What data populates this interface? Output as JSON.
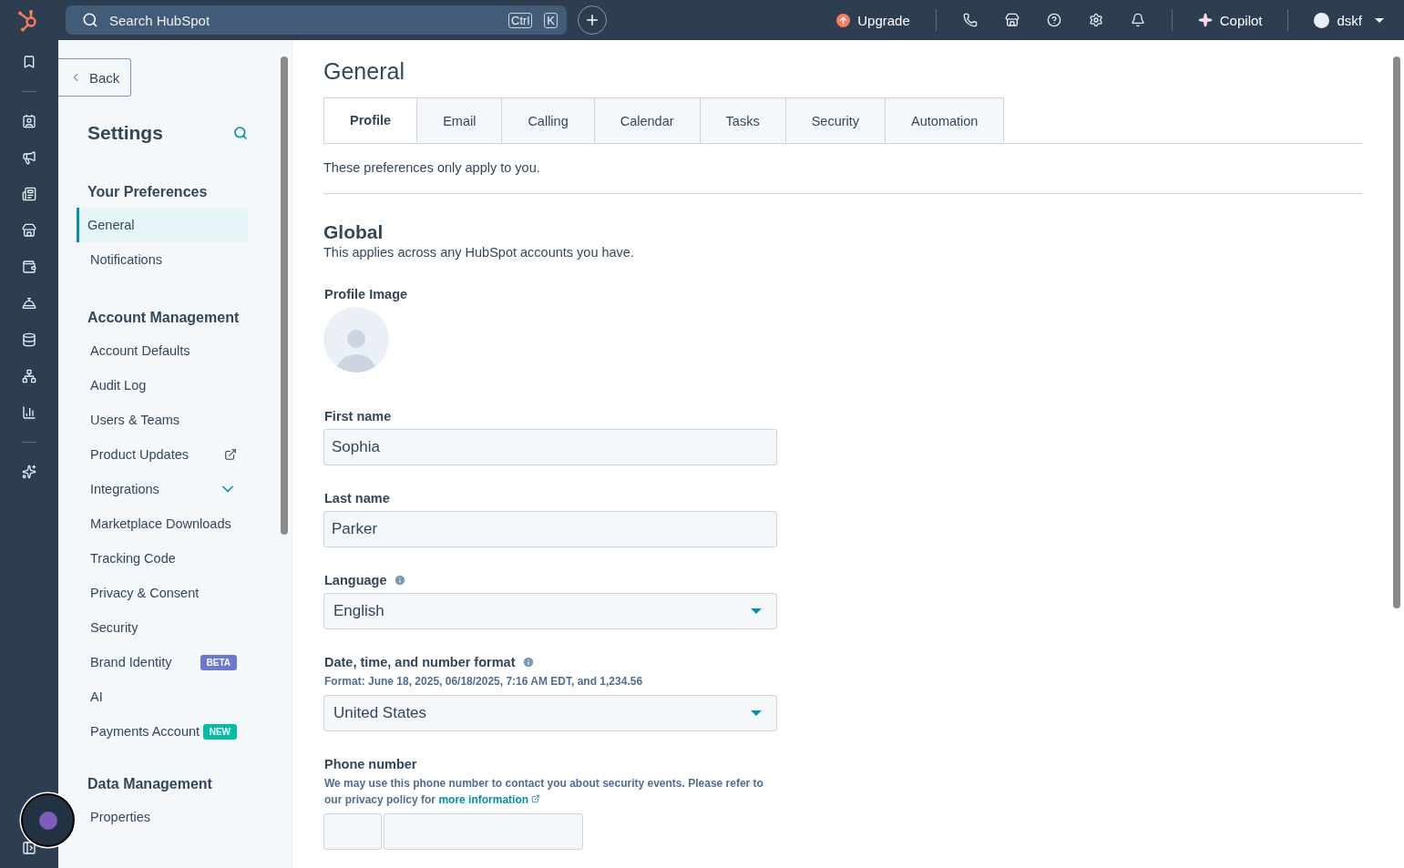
{
  "topbar": {
    "search": {
      "placeholder": "Search HubSpot",
      "keys": [
        "Ctrl",
        "K"
      ]
    },
    "upgrade": "Upgrade",
    "copilot": "Copilot",
    "user": "dskf"
  },
  "sidebar": {
    "back": "Back",
    "title": "Settings",
    "sections": [
      {
        "heading": "Your Preferences",
        "items": [
          {
            "label": "General",
            "selected": true,
            "kind": "link"
          },
          {
            "label": "Notifications",
            "selected": false,
            "kind": "link"
          }
        ]
      },
      {
        "heading": "Account Management",
        "items": [
          {
            "label": "Account Defaults",
            "selected": false,
            "kind": "link"
          },
          {
            "label": "Audit Log",
            "selected": false,
            "kind": "link"
          },
          {
            "label": "Users & Teams",
            "selected": false,
            "kind": "link"
          },
          {
            "label": "Product Updates",
            "selected": false,
            "kind": "external"
          },
          {
            "label": "Integrations",
            "selected": false,
            "kind": "expand"
          },
          {
            "label": "Marketplace Downloads",
            "selected": false,
            "kind": "link"
          },
          {
            "label": "Tracking Code",
            "selected": false,
            "kind": "link"
          },
          {
            "label": "Privacy & Consent",
            "selected": false,
            "kind": "link"
          },
          {
            "label": "Security",
            "selected": false,
            "kind": "link"
          },
          {
            "label": "Brand Identity",
            "selected": false,
            "kind": "badge",
            "badge": "BETA",
            "color": "#6a78d1"
          },
          {
            "label": "AI",
            "selected": false,
            "kind": "link"
          },
          {
            "label": "Payments Account",
            "selected": false,
            "kind": "badge",
            "badge": "NEW",
            "color": "#00bda5"
          }
        ]
      },
      {
        "heading": "Data Management",
        "items": [
          {
            "label": "Properties",
            "selected": false,
            "kind": "link"
          }
        ]
      }
    ]
  },
  "page": {
    "title": "General",
    "tabs": [
      {
        "label": "Profile",
        "selected": true
      },
      {
        "label": "Email",
        "selected": false
      },
      {
        "label": "Calling",
        "selected": false
      },
      {
        "label": "Calendar",
        "selected": false
      },
      {
        "label": "Tasks",
        "selected": false
      },
      {
        "label": "Security",
        "selected": false
      },
      {
        "label": "Automation",
        "selected": false
      }
    ],
    "note": "These preferences only apply to you.",
    "section": {
      "title": "Global",
      "subtitle": "This applies across any HubSpot accounts you have."
    },
    "profile_image_label": "Profile Image",
    "fields": [
      {
        "kind": "text",
        "label": "First name",
        "value": "Sophia",
        "info": false
      },
      {
        "kind": "text",
        "label": "Last name",
        "value": "Parker",
        "info": false
      },
      {
        "kind": "select",
        "label": "Language",
        "value": "English",
        "info": true
      },
      {
        "kind": "select",
        "label": "Date, time, and number format",
        "hint": "Format: June 18, 2025, 06/18/2025, 7:16 AM EDT, and 1,234.56",
        "value": "United States",
        "info": true
      },
      {
        "kind": "phone",
        "label": "Phone number",
        "hint": "We may use this phone number to contact you about security events. Please refer to our privacy policy for",
        "link": "more information",
        "info": false
      }
    ]
  }
}
